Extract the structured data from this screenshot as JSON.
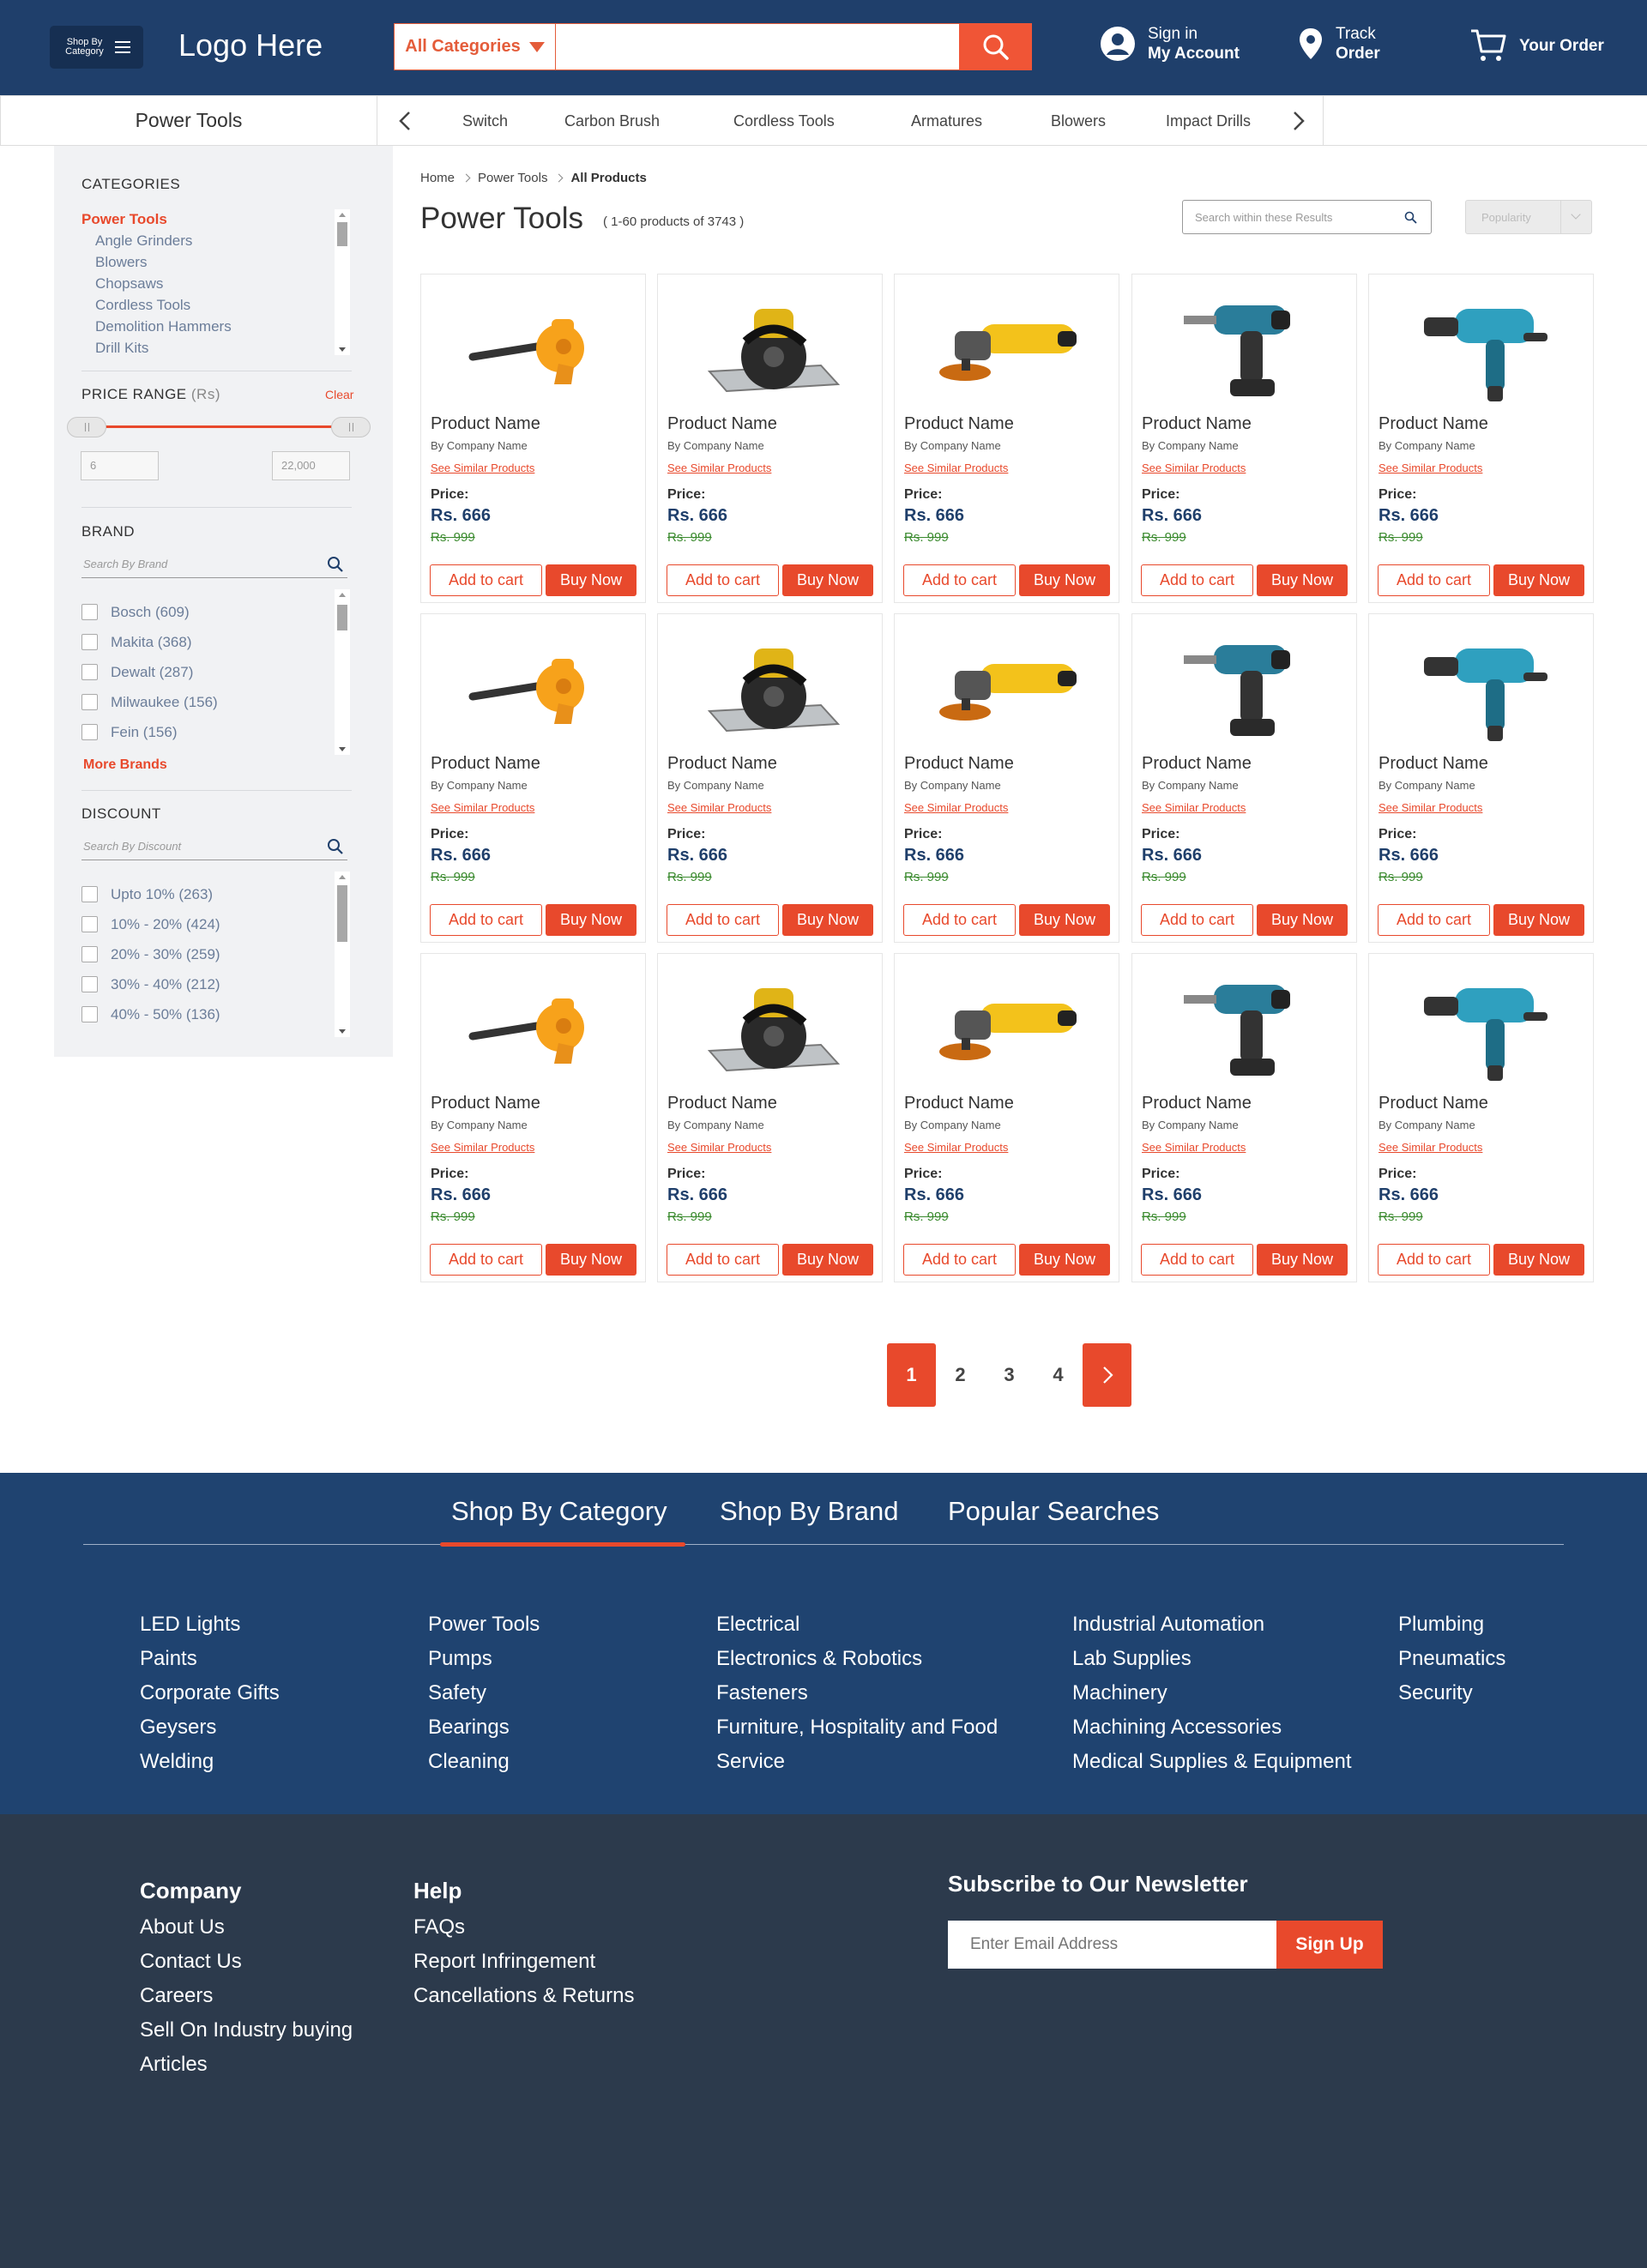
{
  "header": {
    "shop_by_category": "Shop By Category",
    "logo": "Logo Here",
    "category_select": "All Categories",
    "search_placeholder": "",
    "sign_in_line1": "Sign in",
    "sign_in_line2": "My Account",
    "track_line1": "Track",
    "track_line2": "Order",
    "order_label": "Your Order"
  },
  "subnav": {
    "title": "Power Tools",
    "links": [
      "Switch",
      "Carbon Brush",
      "Cordless Tools",
      "Armatures",
      "Blowers",
      "Impact Drills"
    ]
  },
  "sidebar": {
    "categories_heading": "CATEGORIES",
    "categories": [
      "Power Tools",
      "Angle Grinders",
      "Blowers",
      "Chopsaws",
      "Cordless Tools",
      "Demolition Hammers",
      "Drill Kits"
    ],
    "price_heading": "PRICE RANGE",
    "price_unit": "(Rs)",
    "clear_label": "Clear",
    "price_min": "6",
    "price_max": "22,000",
    "brand_heading": "BRAND",
    "brand_search_placeholder": "Search By Brand",
    "brands": [
      "Bosch (609)",
      "Makita (368)",
      "Dewalt (287)",
      "Milwaukee (156)",
      "Fein (156)"
    ],
    "more_brands": "More Brands",
    "discount_heading": "DISCOUNT",
    "discount_search_placeholder": "Search By Discount",
    "discounts": [
      "Upto 10% (263)",
      "10% - 20% (424)",
      "20% - 30% (259)",
      "30% - 40% (212)",
      "40% - 50% (136)"
    ]
  },
  "breadcrumb": [
    "Home",
    "Power Tools",
    "All Products"
  ],
  "listing": {
    "title": "Power Tools",
    "count_note": "( 1-60 products of 3743 )",
    "search_within_placeholder": "Search within  these Results",
    "sort_value": "Popularity"
  },
  "product_template": {
    "name": "Product Name",
    "by": "By",
    "company": "Company Name",
    "similar": "See Similar Products",
    "price_label": "Price:",
    "price": "Rs. 666",
    "old_price": "Rs. 999",
    "add_to_cart": "Add to cart",
    "buy_now": "Buy Now"
  },
  "product_images": [
    "blower",
    "circular-saw",
    "angle-grinder",
    "impact-driver",
    "impact-wrench"
  ],
  "pagination": [
    "1",
    "2",
    "3",
    "4"
  ],
  "footer_tabs": [
    "Shop By Category",
    "Shop By Brand",
    "Popular Searches"
  ],
  "footer_columns": [
    [
      "LED Lights",
      "Paints",
      "Corporate Gifts",
      "Geysers",
      "Welding"
    ],
    [
      "Power Tools",
      "Pumps",
      "Safety",
      "Bearings",
      "Cleaning"
    ],
    [
      "Electrical",
      "Electronics & Robotics",
      "Fasteners",
      "Furniture, Hospitality and Food",
      "Service"
    ],
    [
      "Industrial Automation",
      "Lab Supplies",
      "Machinery",
      "Machining Accessories",
      "Medical Supplies & Equipment"
    ],
    [
      "Plumbing",
      "Pneumatics",
      "Security"
    ]
  ],
  "footer_bottom": {
    "company_heading": "Company",
    "company_links": [
      "About Us",
      "Contact Us",
      "Careers",
      "Sell On Industry buying",
      "Articles"
    ],
    "help_heading": "Help",
    "help_links": [
      "FAQs",
      "Report Infringement",
      "Cancellations & Returns"
    ],
    "newsletter_heading": "Subscribe to Our Newsletter",
    "email_placeholder": "Enter Email Address",
    "signup_label": "Sign Up"
  },
  "colors": {
    "header_bg": "#1f3f6b",
    "accent": "#e8492c",
    "footer_cat_bg": "#1f4370",
    "footer_bottom_bg": "#2c3a4c"
  }
}
